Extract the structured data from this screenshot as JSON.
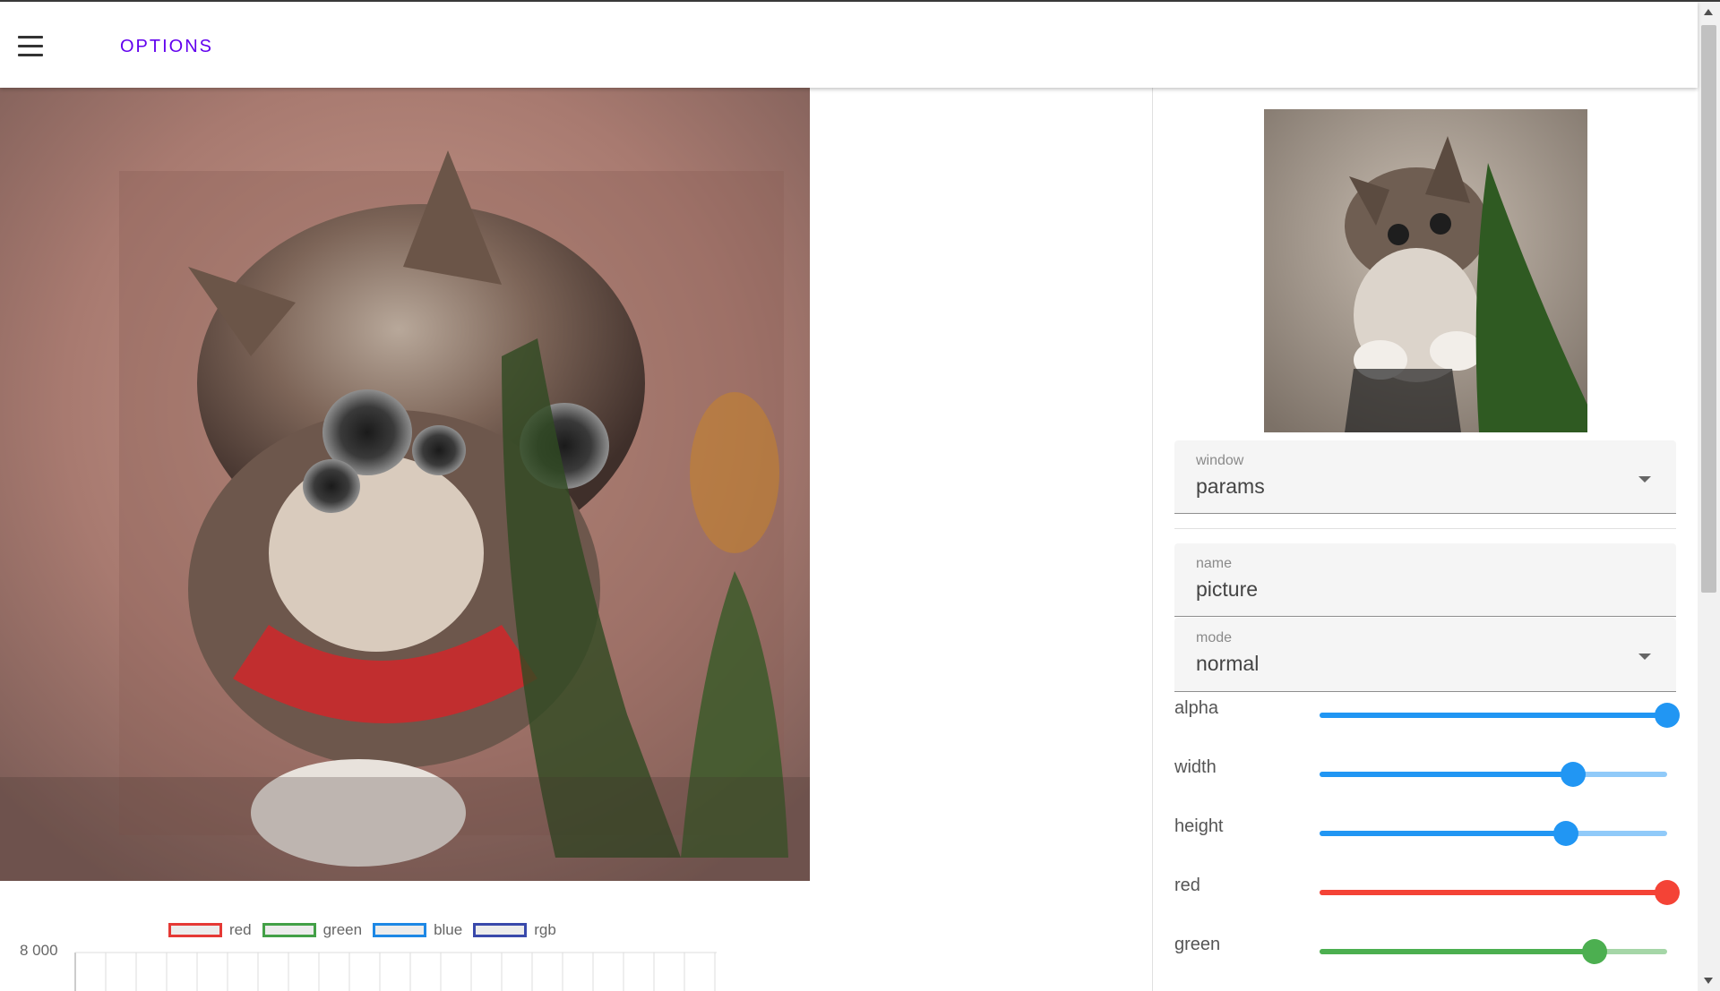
{
  "appbar": {
    "options_label": "OPTIONS"
  },
  "panel": {
    "window_field": {
      "label": "window",
      "value": "params"
    },
    "name_field": {
      "label": "name",
      "value": "picture"
    },
    "mode_field": {
      "label": "mode",
      "value": "normal"
    },
    "sliders": [
      {
        "label": "alpha",
        "value": 1.0,
        "color": "#2196f3",
        "track_color": "#90caf9"
      },
      {
        "label": "width",
        "value": 0.73,
        "color": "#2196f3",
        "track_color": "#90caf9"
      },
      {
        "label": "height",
        "value": 0.71,
        "color": "#2196f3",
        "track_color": "#90caf9"
      },
      {
        "label": "red",
        "value": 1.0,
        "color": "#f44336",
        "track_color": "#ef9a9a"
      },
      {
        "label": "green",
        "value": 0.79,
        "color": "#4caf50",
        "track_color": "#a5d6a7"
      }
    ]
  },
  "histogram": {
    "legend": [
      {
        "label": "red",
        "color": "#e53935"
      },
      {
        "label": "green",
        "color": "#43a047"
      },
      {
        "label": "blue",
        "color": "#1e88e5"
      },
      {
        "label": "rgb",
        "color": "#3949ab"
      }
    ],
    "ytick_top": "8 000"
  }
}
